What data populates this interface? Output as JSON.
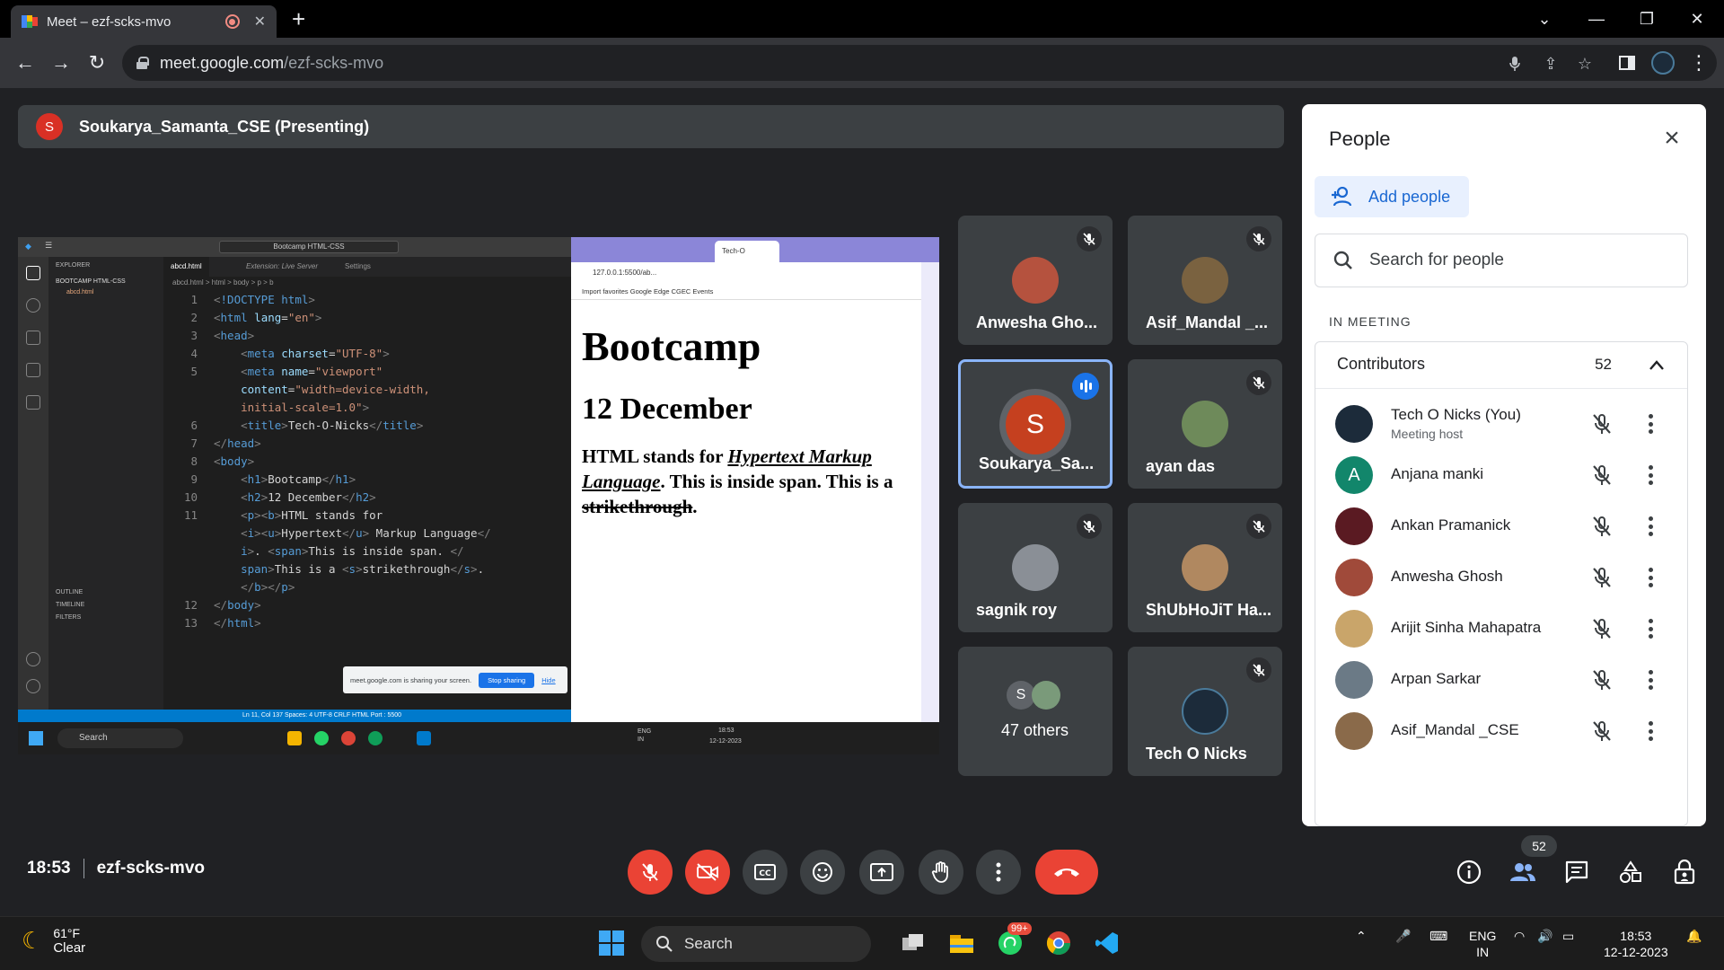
{
  "browser": {
    "tab_title": "Meet – ezf-scks-mvo",
    "url_host": "meet.google.com",
    "url_path": "/ezf-scks-mvo"
  },
  "presenting": {
    "avatar_letter": "S",
    "label": "Soukarya_Samanta_CSE (Presenting)"
  },
  "shared_screen": {
    "vscode": {
      "search": "Bootcamp HTML-CSS",
      "explorer_title": "EXPLORER",
      "folder": "BOOTCAMP HTML-CSS",
      "file": "abcd.html",
      "tabs": [
        "abcd.html",
        "Extension: Live Server",
        "Settings"
      ],
      "breadcrumb": "abcd.html > html > body > p > b",
      "outline": "OUTLINE",
      "timeline": "TIMELINE",
      "filters": "FILTERS",
      "status": "Ln 11, Col 137   Spaces: 4   UTF-8   CRLF   HTML   Port : 5500",
      "share_notice": "meet.google.com is sharing your screen.",
      "stop_sharing": "Stop sharing",
      "hide": "Hide"
    },
    "inner_browser": {
      "tab": "Tech-O",
      "address": "127.0.0.1:5500/ab...",
      "bookmarks": "Import favorites   Google   Edge   CGEC   Events",
      "h1": "Bootcamp",
      "h2": "12 December",
      "p1": "HTML stands for ",
      "p_link": "Hypertext Markup Language",
      "p2": ". This is inside span. This is a ",
      "p_strike": "strikethrough",
      "p3": "."
    },
    "taskbar_search": "Search",
    "lang": "ENG IN",
    "clock": "18:53",
    "date": "12-12-2023"
  },
  "tiles": [
    {
      "name": "Anwesha Gho...",
      "muted": true
    },
    {
      "name": "Asif_Mandal _...",
      "muted": true
    },
    {
      "name": "Soukarya_Sa...",
      "avatar_letter": "S",
      "speaking": true
    },
    {
      "name": "ayan das",
      "muted": true
    },
    {
      "name": "sagnik roy",
      "muted": true
    },
    {
      "name": "ShUbHoJiT Ha...",
      "muted": true
    },
    {
      "name": "47 others",
      "avatar_letter": "S"
    },
    {
      "name": "Tech O Nicks",
      "muted": true
    }
  ],
  "people_panel": {
    "title": "People",
    "add_people": "Add people",
    "search_placeholder": "Search for people",
    "section": "IN MEETING",
    "group_label": "Contributors",
    "group_count": "52",
    "people": [
      {
        "name": "Tech O Nicks (You)",
        "sub": "Meeting host",
        "color": "#1c2b3a"
      },
      {
        "name": "Anjana manki",
        "letter": "A",
        "color": "#12866b"
      },
      {
        "name": "Ankan Pramanick",
        "color": "#5a1a22"
      },
      {
        "name": "Anwesha Ghosh",
        "color": "#a04a3a"
      },
      {
        "name": "Arijit Sinha Mahapatra",
        "color": "#c9a56a"
      },
      {
        "name": "Arpan Sarkar",
        "color": "#6b7a86"
      },
      {
        "name": "Asif_Mandal _CSE",
        "color": "#8a6a4a"
      }
    ]
  },
  "bottom": {
    "time": "18:53",
    "meeting_code": "ezf-scks-mvo",
    "people_count": "52"
  },
  "taskbar": {
    "temp": "61°F",
    "condition": "Clear",
    "search": "Search",
    "whatsapp_badge": "99+",
    "lang1": "ENG",
    "lang2": "IN",
    "time": "18:53",
    "date": "12-12-2023"
  }
}
